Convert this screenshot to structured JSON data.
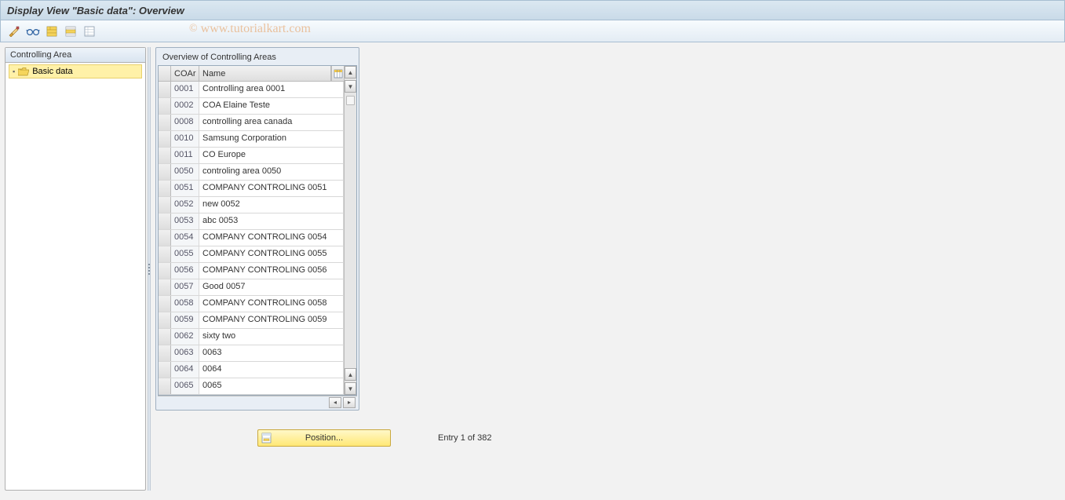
{
  "title": "Display View \"Basic data\": Overview",
  "watermark": "www.tutorialkart.com",
  "toolbar": {
    "items": [
      "toggle",
      "glasses",
      "select-all",
      "select-block",
      "deselect-all"
    ]
  },
  "tree": {
    "header": "Controlling Area",
    "items": [
      {
        "label": "Basic data",
        "selected": true
      }
    ]
  },
  "table": {
    "title": "Overview of Controlling Areas",
    "columns": {
      "coar": "COAr",
      "name": "Name"
    },
    "rows": [
      {
        "coar": "0001",
        "name": "Controlling area 0001"
      },
      {
        "coar": "0002",
        "name": "COA Elaine Teste"
      },
      {
        "coar": "0008",
        "name": "controlling area canada"
      },
      {
        "coar": "0010",
        "name": "Samsung Corporation"
      },
      {
        "coar": "0011",
        "name": "CO Europe"
      },
      {
        "coar": "0050",
        "name": "controling area 0050"
      },
      {
        "coar": "0051",
        "name": "COMPANY CONTROLING 0051"
      },
      {
        "coar": "0052",
        "name": "new 0052"
      },
      {
        "coar": "0053",
        "name": "abc 0053"
      },
      {
        "coar": "0054",
        "name": "COMPANY CONTROLING 0054"
      },
      {
        "coar": "0055",
        "name": "COMPANY CONTROLING 0055"
      },
      {
        "coar": "0056",
        "name": "COMPANY CONTROLING 0056"
      },
      {
        "coar": "0057",
        "name": "Good 0057"
      },
      {
        "coar": "0058",
        "name": "COMPANY CONTROLING 0058"
      },
      {
        "coar": "0059",
        "name": "COMPANY CONTROLING 0059"
      },
      {
        "coar": "0062",
        "name": "sixty two"
      },
      {
        "coar": "0063",
        "name": "0063"
      },
      {
        "coar": "0064",
        "name": "0064"
      },
      {
        "coar": "0065",
        "name": "0065"
      }
    ]
  },
  "footer": {
    "position_label": "Position...",
    "entry_text": "Entry 1 of 382"
  }
}
